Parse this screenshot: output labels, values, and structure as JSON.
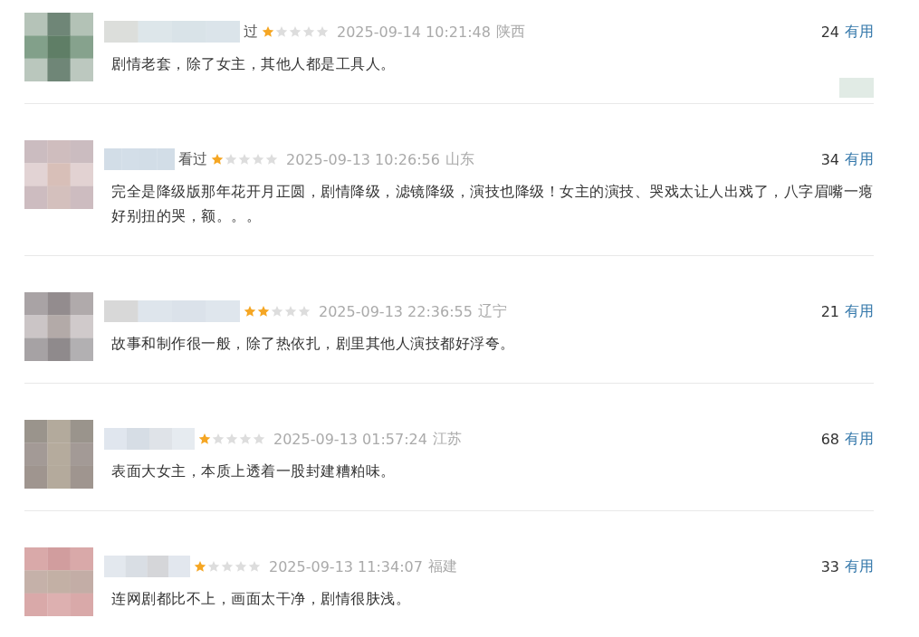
{
  "reviews": [
    {
      "status": "过",
      "stars": 1,
      "time": "2025-09-14 10:21:48",
      "region": "陕西",
      "votes": "24",
      "vote_label": "有用",
      "comment": "剧情老套，除了女主，其他人都是工具人。",
      "blurred_badge": true
    },
    {
      "status": "看过",
      "stars": 1,
      "time": "2025-09-13 10:26:56",
      "region": "山东",
      "votes": "34",
      "vote_label": "有用",
      "comment": "完全是降级版那年花开月正圆，剧情降级，滤镜降级，演技也降级！女主的演技、哭戏太让人出戏了，八字眉嘴一瘪好别扭的哭，额。。。",
      "blurred_badge": false
    },
    {
      "stars": 2,
      "time": "2025-09-13 22:36:55",
      "region": "辽宁",
      "votes": "21",
      "vote_label": "有用",
      "comment": "故事和制作很一般，除了热依扎，剧里其他人演技都好浮夸。",
      "blurred_badge": false
    },
    {
      "stars": 1,
      "time": "2025-09-13 01:57:24",
      "region": "江苏",
      "votes": "68",
      "vote_label": "有用",
      "comment": "表面大女主，本质上透着一股封建糟粕味。",
      "blurred_badge": false
    },
    {
      "stars": 1,
      "time": "2025-09-13 11:34:07",
      "region": "福建",
      "votes": "33",
      "vote_label": "有用",
      "comment": "连网剧都比不上，画面太干净，剧情很肤浅。",
      "blurred_badge": false
    }
  ]
}
